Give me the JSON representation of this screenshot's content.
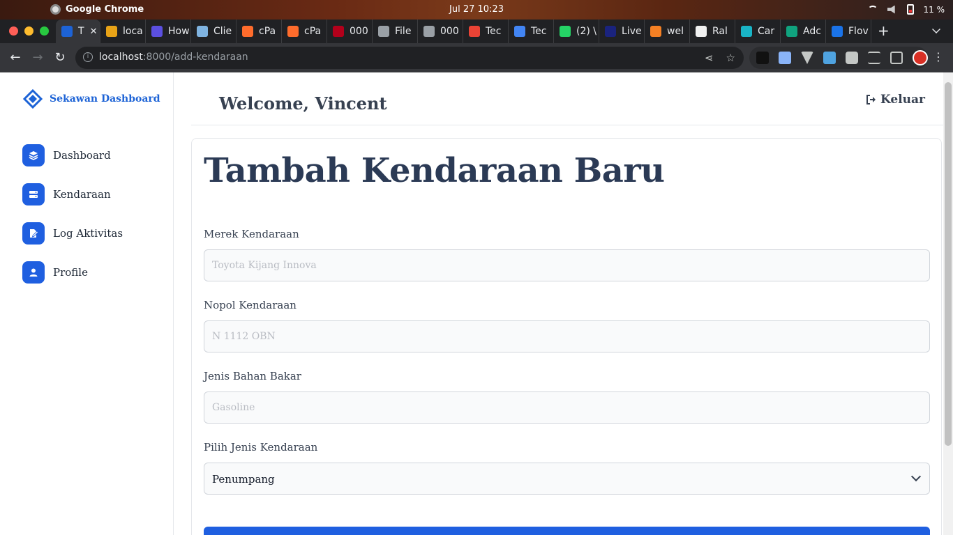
{
  "os": {
    "app_name": "Google Chrome",
    "clock": "Jul 27  10:23",
    "battery": "11 %"
  },
  "browser": {
    "tabs": [
      {
        "label": "T",
        "favicon_color": "#1d63d6",
        "active": true
      },
      {
        "label": "loca",
        "favicon_color": "#e8a317"
      },
      {
        "label": "How",
        "favicon_color": "#5b4fe0"
      },
      {
        "label": "Clie",
        "favicon_color": "#7fb3e0"
      },
      {
        "label": "cPa",
        "favicon_color": "#ff6c2c"
      },
      {
        "label": "cPa",
        "favicon_color": "#ff6c2c"
      },
      {
        "label": "000",
        "favicon_color": "#b3001b"
      },
      {
        "label": "File",
        "favicon_color": "#9aa0a6"
      },
      {
        "label": "000",
        "favicon_color": "#9aa0a6"
      },
      {
        "label": "Tec",
        "favicon_color": "#ea4335"
      },
      {
        "label": "Tec",
        "favicon_color": "#4285f4"
      },
      {
        "label": "(2) \\",
        "favicon_color": "#25d366"
      },
      {
        "label": "Live",
        "favicon_color": "#1a237e"
      },
      {
        "label": "wel",
        "favicon_color": "#f48024"
      },
      {
        "label": "Ral",
        "favicon_color": "#f0f0f0"
      },
      {
        "label": "Car",
        "favicon_color": "#19b4c6"
      },
      {
        "label": "Adc",
        "favicon_color": "#10a37f"
      },
      {
        "label": "Flov",
        "favicon_color": "#1a73e8"
      }
    ],
    "close_glyph": "✕",
    "new_tab_glyph": "+",
    "url_host": "localhost",
    "url_path": ":8000/add-kendaraan"
  },
  "sidebar": {
    "brand": "Sekawan Dashboard",
    "items": [
      {
        "label": "Dashboard",
        "icon": "layers-icon"
      },
      {
        "label": "Kendaraan",
        "icon": "server-icon"
      },
      {
        "label": "Log Aktivitas",
        "icon": "file-edit-icon"
      },
      {
        "label": "Profile",
        "icon": "user-icon"
      }
    ]
  },
  "header": {
    "welcome": "Welcome, Vincent",
    "logout_label": "Keluar"
  },
  "form": {
    "title": "Tambah Kendaraan Baru",
    "fields": [
      {
        "label": "Merek Kendaraan",
        "placeholder": "Toyota Kijang Innova",
        "value": ""
      },
      {
        "label": "Nopol Kendaraan",
        "placeholder": "N 1112 OBN",
        "value": ""
      },
      {
        "label": "Jenis Bahan Bakar",
        "placeholder": "Gasoline",
        "value": ""
      }
    ],
    "select": {
      "label": "Pilih Jenis Kendaraan",
      "selected": "Penumpang"
    }
  },
  "colors": {
    "brand_blue": "#1f5fe0",
    "title_text": "#2b3a55"
  }
}
